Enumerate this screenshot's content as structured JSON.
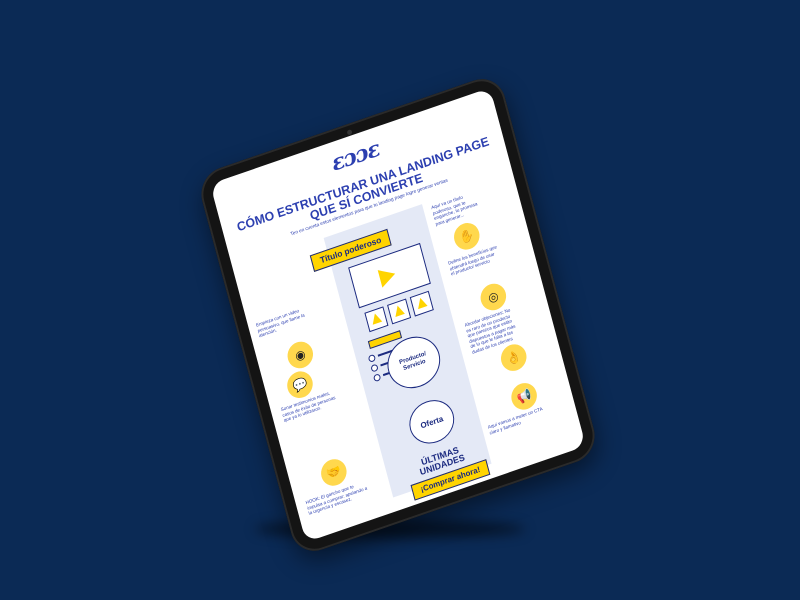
{
  "tablet": {
    "logo": "ɛɔɔɛ",
    "logo_tagline": "",
    "title": "Cómo estructurar una landing page que sí convierte",
    "subtitle": "Ten en cuenta estos elementos para que tu landing page logre generar ventas",
    "labels": {
      "titulo": "Título poderoso",
      "producto": "Producto/ Servicio",
      "oferta": "Oferta",
      "ultimas": "ÚLTIMAS UNIDADES",
      "comprar": "¡Comprar ahora!"
    },
    "notes": {
      "titulo_note": "Aquí va un título poderoso, que te enganche, tu promesa para generar...",
      "video_note": "Empieza con un video persuasivo, que llame la atención.",
      "beneficios_note": "Define los beneficios que obtendrá luego de usar el producto/ servicio",
      "testimonios_note": "Sonar testimonios reales, casos de éxito de personas que ya lo utilizaron.",
      "objeciones_note": "Abordar objeciones: No es raro de un producto que parezca que están dispuestos a pagar más de lo que le falta a las dudas de los clientes",
      "cta_note": "Aquí vamos a meter un CTA claro y llamativo",
      "hook_note": "HOOK: El gancho que te impulsa a comprar: apelando a la urgencia y escasez."
    }
  }
}
